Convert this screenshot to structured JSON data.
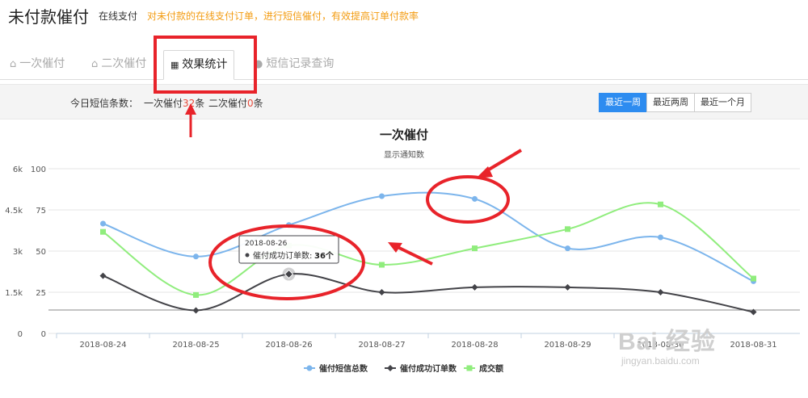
{
  "header": {
    "title": "未付款催付",
    "subtitle": "在线支付",
    "description": "对未付款的在线支付订单，进行短信催付，有效提高订单付款率"
  },
  "tabs": [
    {
      "label": "一次催付",
      "icon": "home-icon",
      "active": false
    },
    {
      "label": "二次催付",
      "icon": "home-icon",
      "active": false
    },
    {
      "label": "效果统计",
      "icon": "table-icon",
      "active": true
    },
    {
      "label": "短信记录查询",
      "icon": "circle-icon",
      "active": false
    }
  ],
  "filter": {
    "today_label": "今日短信条数：",
    "first_prefix": "一次催付",
    "first_count": "32",
    "first_suffix": "条",
    "second_prefix": "二次催付",
    "second_count": "0",
    "second_suffix": "条",
    "ranges": [
      "最近一周",
      "最近两周",
      "最近一个月"
    ],
    "active_range": "最近一周"
  },
  "colors": {
    "accent": "#2d8cf0",
    "highlight": "#e74c3c",
    "series_blue": "#7cb5ec",
    "series_black": "#434348",
    "series_green": "#90ed7d",
    "annotation_red": "#e8232a"
  },
  "tooltip": {
    "date": "2018-08-26",
    "label": "催付成功订单数:",
    "value": "36个"
  },
  "watermark": {
    "brand": "Bai 经验",
    "url": "jingyan.baidu.com"
  },
  "chart_data": {
    "type": "line",
    "title": "一次催付",
    "subtitle": "显示通知数",
    "categories": [
      "2018-08-24",
      "2018-08-25",
      "2018-08-26",
      "2018-08-27",
      "2018-08-28",
      "2018-08-29",
      "2018-08-30",
      "2018-08-31"
    ],
    "left_axis": {
      "ticks": [
        "0",
        "1.5k",
        "3k",
        "4.5k",
        "6k"
      ],
      "range": [
        0,
        6000
      ]
    },
    "right_axis": {
      "ticks": [
        "0",
        "25",
        "50",
        "75",
        "100"
      ],
      "range": [
        0,
        100
      ]
    },
    "series": [
      {
        "name": "催付短信总数",
        "color": "#7cb5ec",
        "marker": "circle",
        "values": [
          4000,
          2800,
          3950,
          5000,
          4900,
          3100,
          3500,
          1900
        ]
      },
      {
        "name": "催付成功订单数",
        "color": "#434348",
        "marker": "diamond",
        "values": [
          35,
          14,
          36,
          25,
          28,
          28,
          25,
          13
        ]
      },
      {
        "name": "成交额",
        "color": "#90ed7d",
        "marker": "square",
        "values": [
          3700,
          1400,
          3200,
          2500,
          3100,
          3800,
          4700,
          2000
        ]
      }
    ],
    "grid": true,
    "legend_position": "bottom-center"
  }
}
